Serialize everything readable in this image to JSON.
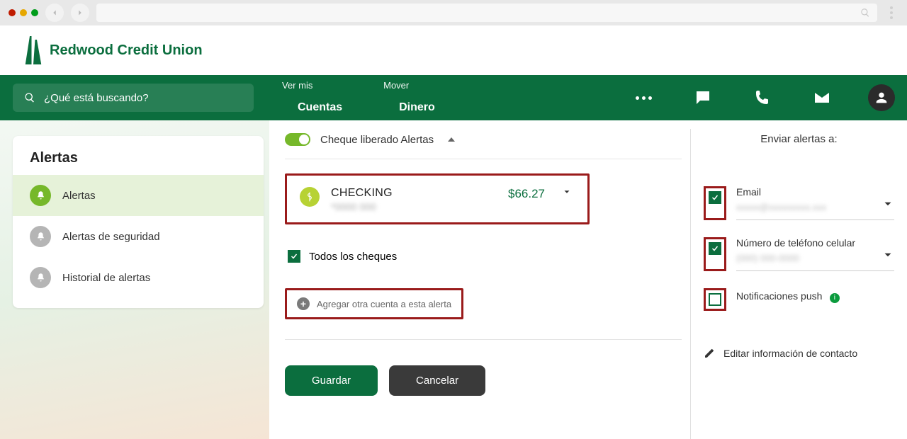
{
  "brand": "Redwood Credit Union",
  "search": {
    "placeholder": "¿Qué está buscando?"
  },
  "header": {
    "view": {
      "sub": "Ver mis",
      "main": "Cuentas"
    },
    "move": {
      "sub": "Mover",
      "main": "Dinero"
    }
  },
  "sidebar": {
    "title": "Alertas",
    "items": [
      "Alertas",
      "Alertas de seguridad",
      "Historial de alertas"
    ]
  },
  "alert": {
    "toggle_label": "Cheque liberado Alertas",
    "account": {
      "name": "CHECKING",
      "masked": "*0000 000",
      "amount": "$66.27"
    },
    "all_checks": "Todos los cheques",
    "add_account": "Agregar otra cuenta a esta alerta"
  },
  "buttons": {
    "save": "Guardar",
    "cancel": "Cancelar"
  },
  "send": {
    "title": "Enviar alertas a:",
    "email_label": "Email",
    "email_value": "xxxxx@xxxxxxxxx.xxx",
    "phone_label": "Número de teléfono celular",
    "phone_value": "(000) 000-0000",
    "push_label": "Notificaciones push",
    "edit": "Editar información de contacto"
  }
}
